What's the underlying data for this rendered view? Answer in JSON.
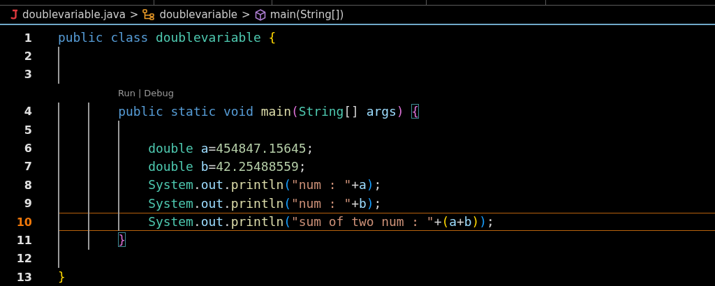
{
  "breadcrumbs": [
    {
      "kind": "file",
      "text": "doublevariable.java"
    },
    {
      "kind": "class",
      "text": "doublevariable"
    },
    {
      "kind": "method",
      "text": "main(String[])"
    }
  ],
  "breadcrumb_separator": ">",
  "editor": {
    "lines": [
      {
        "number": "1",
        "current": false,
        "tokens": [
          {
            "text": "public class ",
            "kind": "keyword"
          },
          {
            "text": "doublevariable ",
            "kind": "type"
          },
          {
            "text": "{",
            "kind": "brace1",
            "matched": false
          }
        ]
      },
      {
        "number": "2",
        "current": false
      },
      {
        "number": "3",
        "current": false
      },
      {
        "number": "4",
        "current": false,
        "codelens": {
          "actions": [
            "Run",
            "Debug"
          ],
          "separator": "|"
        },
        "tokens": [
          {
            "text": "        public static void ",
            "kind": "keyword"
          },
          {
            "text": "main",
            "kind": "method"
          },
          {
            "text": "(",
            "kind": "brace2",
            "matched": false
          },
          {
            "text": "String",
            "kind": "type"
          },
          {
            "text": "[] ",
            "kind": "plain"
          },
          {
            "text": "args",
            "kind": "variable"
          },
          {
            "text": ")",
            "kind": "brace2",
            "matched": false
          },
          {
            "text": " {",
            "kind": "brace2",
            "matched": true
          }
        ]
      },
      {
        "number": "5",
        "current": false
      },
      {
        "number": "6",
        "current": false,
        "tokens": [
          {
            "text": "            double ",
            "kind": "type"
          },
          {
            "text": "a",
            "kind": "variable"
          },
          {
            "text": "=",
            "kind": "plain"
          },
          {
            "text": "454847.15645",
            "kind": "number"
          },
          {
            "text": ";",
            "kind": "plain"
          }
        ]
      },
      {
        "number": "7",
        "current": false,
        "tokens": [
          {
            "text": "            double ",
            "kind": "type"
          },
          {
            "text": "b",
            "kind": "variable"
          },
          {
            "text": "=",
            "kind": "plain"
          },
          {
            "text": "42.25488559",
            "kind": "number"
          },
          {
            "text": ";",
            "kind": "plain"
          }
        ]
      },
      {
        "number": "8",
        "current": false,
        "tokens": [
          {
            "text": "            System",
            "kind": "type"
          },
          {
            "text": ".",
            "kind": "plain"
          },
          {
            "text": "out",
            "kind": "variable"
          },
          {
            "text": ".",
            "kind": "plain"
          },
          {
            "text": "println",
            "kind": "method"
          },
          {
            "text": "(",
            "kind": "brace3",
            "matched": false
          },
          {
            "text": "\"num : \"",
            "kind": "string"
          },
          {
            "text": "+",
            "kind": "plain"
          },
          {
            "text": "a",
            "kind": "variable"
          },
          {
            "text": ")",
            "kind": "brace3",
            "matched": false
          },
          {
            "text": ";",
            "kind": "plain"
          }
        ]
      },
      {
        "number": "9",
        "current": false,
        "tokens": [
          {
            "text": "            System",
            "kind": "type"
          },
          {
            "text": ".",
            "kind": "plain"
          },
          {
            "text": "out",
            "kind": "variable"
          },
          {
            "text": ".",
            "kind": "plain"
          },
          {
            "text": "println",
            "kind": "method"
          },
          {
            "text": "(",
            "kind": "brace3",
            "matched": false
          },
          {
            "text": "\"num : \"",
            "kind": "string"
          },
          {
            "text": "+",
            "kind": "plain"
          },
          {
            "text": "b",
            "kind": "variable"
          },
          {
            "text": ")",
            "kind": "brace3",
            "matched": false
          },
          {
            "text": ";",
            "kind": "plain"
          }
        ]
      },
      {
        "number": "10",
        "current": true,
        "tokens": [
          {
            "text": "            System",
            "kind": "type"
          },
          {
            "text": ".",
            "kind": "plain"
          },
          {
            "text": "out",
            "kind": "variable"
          },
          {
            "text": ".",
            "kind": "plain"
          },
          {
            "text": "println",
            "kind": "method"
          },
          {
            "text": "(",
            "kind": "brace3",
            "matched": false
          },
          {
            "text": "\"sum of two num : \"",
            "kind": "string"
          },
          {
            "text": "+",
            "kind": "plain"
          },
          {
            "text": "(",
            "kind": "brace1",
            "matched": false
          },
          {
            "text": "a",
            "kind": "variable"
          },
          {
            "text": "+",
            "kind": "plain"
          },
          {
            "text": "b",
            "kind": "variable"
          },
          {
            "text": ")",
            "kind": "brace1",
            "matched": false
          },
          {
            "text": ")",
            "kind": "brace3",
            "matched": false
          },
          {
            "text": ";",
            "kind": "plain"
          }
        ]
      },
      {
        "number": "11",
        "current": false,
        "tokens": [
          {
            "text": "        }",
            "kind": "brace2",
            "matched": true
          }
        ]
      },
      {
        "number": "12",
        "current": false
      },
      {
        "number": "13",
        "current": false,
        "tokens": [
          {
            "text": "}",
            "kind": "brace1",
            "matched": false
          }
        ]
      }
    ]
  }
}
